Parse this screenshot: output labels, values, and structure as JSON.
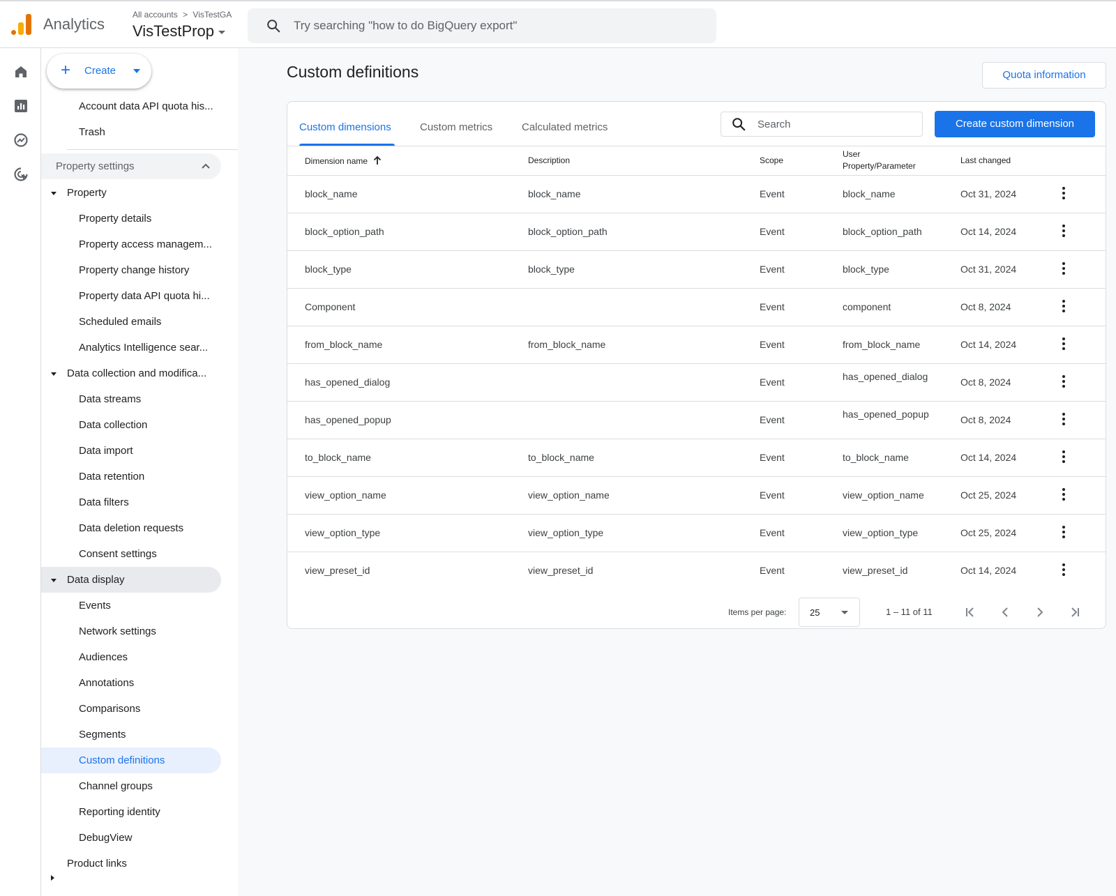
{
  "header": {
    "app_name": "Analytics",
    "breadcrumb_account": "All accounts",
    "breadcrumb_sep": ">",
    "breadcrumb_property": "VisTestGA",
    "property_name": "VisTestProp",
    "search_placeholder": "Try searching \"how to do BigQuery export\""
  },
  "rail": {
    "icons": [
      "home-icon",
      "reports-icon",
      "explore-icon",
      "advertising-icon"
    ]
  },
  "nav": {
    "create_label": "Create",
    "top_items": [
      "Account data API quota his...",
      "Trash"
    ],
    "property_settings_label": "Property settings",
    "property_group": {
      "label": "Property",
      "items": [
        "Property details",
        "Property access managem...",
        "Property change history",
        "Property data API quota hi...",
        "Scheduled emails",
        "Analytics Intelligence sear..."
      ]
    },
    "data_collection_group": {
      "label": "Data collection and modifica...",
      "items": [
        "Data streams",
        "Data collection",
        "Data import",
        "Data retention",
        "Data filters",
        "Data deletion requests",
        "Consent settings"
      ]
    },
    "data_display_group": {
      "label": "Data display",
      "items": [
        "Events",
        "Network settings",
        "Audiences",
        "Annotations",
        "Comparisons",
        "Segments",
        "Custom definitions",
        "Channel groups",
        "Reporting identity",
        "DebugView"
      ]
    },
    "product_links_label": "Product links"
  },
  "main": {
    "title": "Custom definitions",
    "quota_button": "Quota information",
    "tabs": [
      "Custom dimensions",
      "Custom metrics",
      "Calculated metrics"
    ],
    "search_placeholder": "Search",
    "create_button": "Create custom dimension",
    "columns": {
      "name": "Dimension name",
      "description": "Description",
      "scope": "Scope",
      "param_line1": "User",
      "param_line2": "Property/Parameter",
      "last_changed": "Last changed"
    },
    "rows": [
      {
        "name": "block_name",
        "description": "block_name",
        "scope": "Event",
        "param": "block_name",
        "changed": "Oct 31, 2024"
      },
      {
        "name": "block_option_path",
        "description": "block_option_path",
        "scope": "Event",
        "param": "block_option_path",
        "changed": "Oct 14, 2024"
      },
      {
        "name": "block_type",
        "description": "block_type",
        "scope": "Event",
        "param": "block_type",
        "changed": "Oct 31, 2024"
      },
      {
        "name": "Component",
        "description": "",
        "scope": "Event",
        "param": "component",
        "changed": "Oct 8, 2024"
      },
      {
        "name": "from_block_name",
        "description": "from_block_name",
        "scope": "Event",
        "param": "from_block_name",
        "changed": "Oct 14, 2024"
      },
      {
        "name": "has_opened_dialog",
        "description": "",
        "scope": "Event",
        "param": "has_opened_dialog",
        "changed": "Oct 8, 2024"
      },
      {
        "name": "has_opened_popup",
        "description": "",
        "scope": "Event",
        "param": "has_opened_popup",
        "changed": "Oct 8, 2024"
      },
      {
        "name": "to_block_name",
        "description": "to_block_name",
        "scope": "Event",
        "param": "to_block_name",
        "changed": "Oct 14, 2024"
      },
      {
        "name": "view_option_name",
        "description": "view_option_name",
        "scope": "Event",
        "param": "view_option_name",
        "changed": "Oct 25, 2024"
      },
      {
        "name": "view_option_type",
        "description": "view_option_type",
        "scope": "Event",
        "param": "view_option_type",
        "changed": "Oct 25, 2024"
      },
      {
        "name": "view_preset_id",
        "description": "view_preset_id",
        "scope": "Event",
        "param": "view_preset_id",
        "changed": "Oct 14, 2024"
      }
    ],
    "pagination": {
      "items_per_page_label": "Items per page:",
      "items_per_page": "25",
      "range": "1 – 11 of 11"
    }
  },
  "colors": {
    "accent": "#1a73e8",
    "logo_orange": "#e37400",
    "logo_yellow": "#f9ab00"
  }
}
